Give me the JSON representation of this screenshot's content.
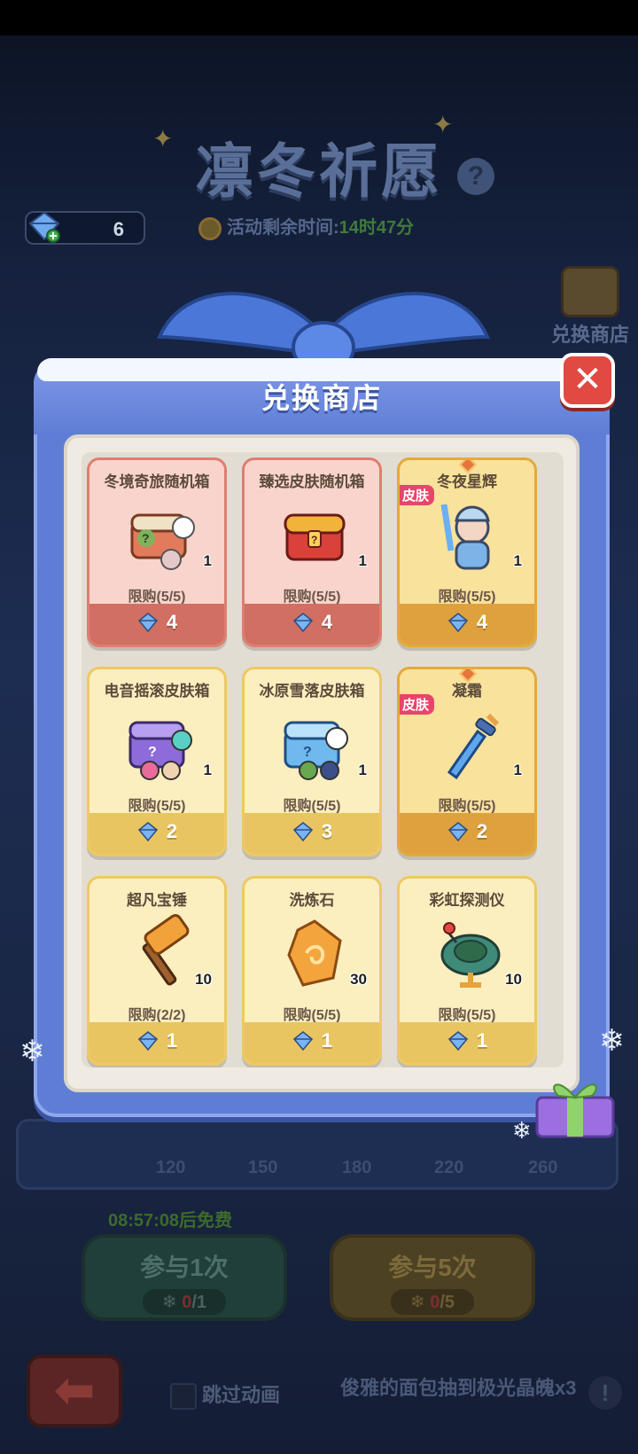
{
  "header": {
    "event_title": "凛冬祈愿",
    "help_icon": "question-icon",
    "currency": {
      "icon": "crystal-gem-icon",
      "value": "6"
    },
    "timer": {
      "label": "活动剩余时间:",
      "value": "14时47分"
    },
    "side_shop_label": "兑换商店"
  },
  "modal": {
    "title": "兑换商店",
    "close_icon": "close-icon",
    "items": [
      {
        "name": "冬境奇旅随机箱",
        "qty": "1",
        "limit": "限购(5/5)",
        "price": "4",
        "style": "pink",
        "skin": false,
        "icon": "random-chest-icon"
      },
      {
        "name": "臻选皮肤随机箱",
        "qty": "1",
        "limit": "限购(5/5)",
        "price": "4",
        "style": "pink",
        "skin": false,
        "icon": "gold-chest-icon"
      },
      {
        "name": "冬夜星辉",
        "qty": "1",
        "limit": "限购(5/5)",
        "price": "4",
        "style": "gold",
        "skin": true,
        "skin_label": "皮肤",
        "icon": "ice-hero-icon"
      },
      {
        "name": "电音摇滚皮肤箱",
        "qty": "1",
        "limit": "限购(5/5)",
        "price": "2",
        "style": "cream",
        "skin": false,
        "icon": "purple-chest-icon"
      },
      {
        "name": "冰原雪落皮肤箱",
        "qty": "1",
        "limit": "限购(5/5)",
        "price": "3",
        "style": "cream",
        "skin": false,
        "icon": "ice-chest-icon"
      },
      {
        "name": "凝霜",
        "qty": "1",
        "limit": "限购(5/5)",
        "price": "2",
        "style": "gold",
        "skin": true,
        "skin_label": "皮肤",
        "icon": "frost-dagger-icon"
      },
      {
        "name": "超凡宝锤",
        "qty": "10",
        "limit": "限购(2/2)",
        "price": "1",
        "style": "cream",
        "skin": false,
        "icon": "hammer-icon"
      },
      {
        "name": "洗炼石",
        "qty": "30",
        "limit": "限购(5/5)",
        "price": "1",
        "style": "cream",
        "skin": false,
        "icon": "refine-stone-icon"
      },
      {
        "name": "彩虹探测仪",
        "qty": "10",
        "limit": "限购(5/5)",
        "price": "1",
        "style": "cream",
        "skin": false,
        "icon": "rainbow-detector-icon"
      }
    ]
  },
  "progress": {
    "milestones": [
      "120",
      "150",
      "180",
      "220",
      "260"
    ]
  },
  "free_timer": "08:57:08后免费",
  "actions": {
    "join_once": {
      "label": "参与1次",
      "cost_have": "0",
      "cost_need": "/1"
    },
    "join_five": {
      "label": "参与5次",
      "cost_have": "0",
      "cost_need": "/5"
    }
  },
  "footer": {
    "skip_label": "跳过动画",
    "ticker": "俊雅的面包抽到极光晶魄x3",
    "back_icon": "back-arrow-icon",
    "info_icon": "exclamation-icon"
  },
  "colors": {
    "modal_blue": "#5e7ed6",
    "card_pink": "#f9d4cc",
    "card_cream": "#fbeebf",
    "card_gold": "#f8e29c",
    "skin_tag": "#e8456b",
    "close_red": "#e04a43"
  }
}
